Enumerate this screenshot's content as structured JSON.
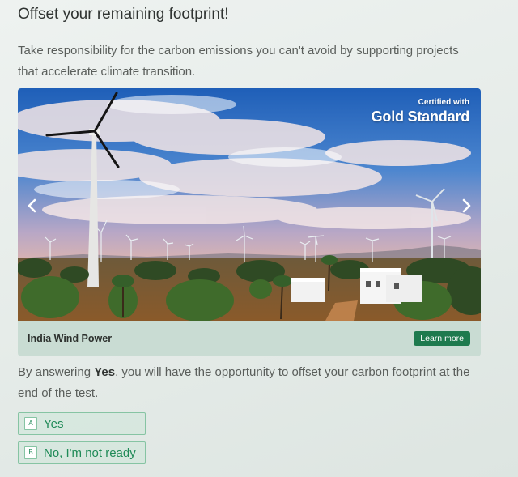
{
  "page": {
    "title": "Offset your remaining footprint!",
    "intro": "Take responsibility for the carbon emissions you can't avoid by supporting projects that accelerate climate transition."
  },
  "carousel": {
    "certified_label": "Certified with",
    "certifier": "Gold Standard",
    "project_name": "India Wind Power",
    "learn_more_label": "Learn more",
    "prev_icon": "chevron-left-icon",
    "next_icon": "chevron-right-icon"
  },
  "question": {
    "prefix": "By answering ",
    "emphasis": "Yes",
    "suffix": ", you will have the opportunity to offset your carbon footprint at the end of the test."
  },
  "options": [
    {
      "key": "A",
      "label": "Yes"
    },
    {
      "key": "B",
      "label": "No, I'm not ready"
    }
  ],
  "colors": {
    "accent_green": "#1e7a4e",
    "option_text": "#1f8a57",
    "option_border": "#86c4a3",
    "card_footer": "#c9dcd3"
  }
}
